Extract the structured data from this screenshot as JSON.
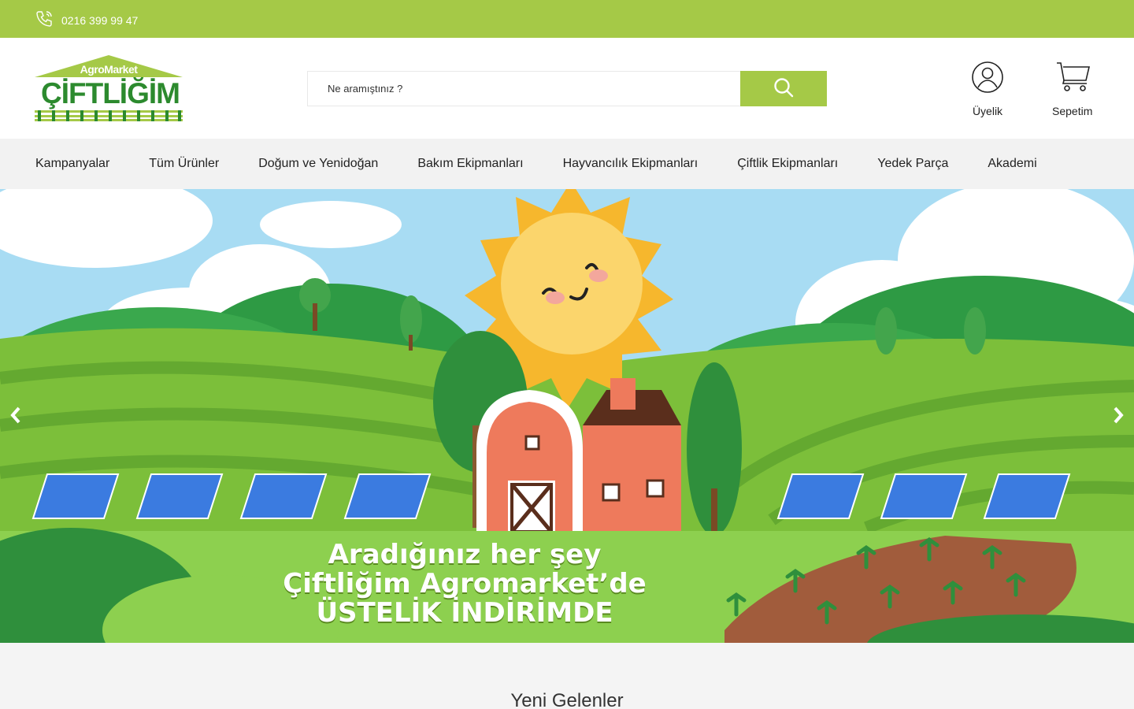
{
  "topbar": {
    "phone": "0216 399 99 47",
    "phone_icon": "phone-icon"
  },
  "header": {
    "logo_small": "AgroMarket",
    "logo_big": "ÇİFTLİĞİM",
    "search_placeholder": "Ne aramıştınız ?",
    "search_icon": "search-icon",
    "member_label": "Üyelik",
    "cart_label": "Sepetim"
  },
  "nav": {
    "items": [
      {
        "label": "Kampanyalar"
      },
      {
        "label": "Tüm Ürünler"
      },
      {
        "label": "Doğum ve Yenidoğan"
      },
      {
        "label": "Bakım Ekipmanları"
      },
      {
        "label": "Hayvancılık Ekipmanları"
      },
      {
        "label": "Çiftlik Ekipmanları"
      },
      {
        "label": "Yedek Parça"
      },
      {
        "label": "Akademi"
      }
    ]
  },
  "hero": {
    "line1": "Aradığınız her şey",
    "line2": "Çiftliğim Agromarket’de",
    "line3": "ÜSTELİK İNDİRİMDE"
  },
  "section": {
    "title": "Yeni Gelenler"
  },
  "colors": {
    "brand_green": "#a5c947",
    "logo_green": "#2c8a2e"
  }
}
